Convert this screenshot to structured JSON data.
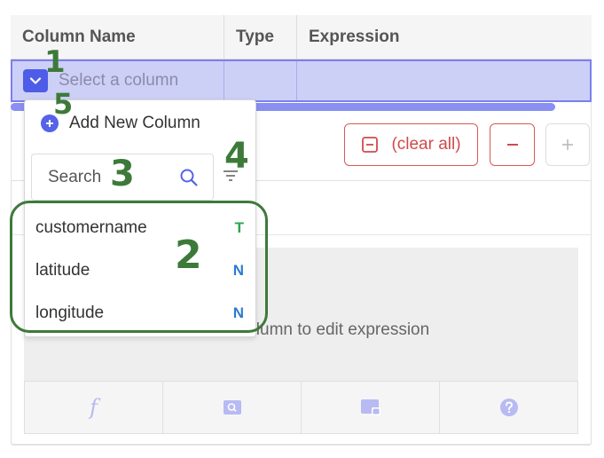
{
  "table": {
    "headers": [
      "Column Name",
      "Type",
      "Expression"
    ],
    "selected_row": {
      "placeholder": "Select a column"
    }
  },
  "actions": {
    "clear_all_label": "(clear all)",
    "minus_label": "−",
    "plus_label": "+"
  },
  "expression": {
    "hint": "Select a column to edit expression",
    "tools": [
      "function-icon",
      "search-box-icon",
      "image-card-icon",
      "help-icon"
    ],
    "function_glyph": "f"
  },
  "dropdown": {
    "add_new_label": "Add New Column",
    "search_placeholder": "Search",
    "options": [
      {
        "name": "customername",
        "type": "T",
        "type_color": "#2ea44f"
      },
      {
        "name": "latitude",
        "type": "N",
        "type_color": "#2b7bd0"
      },
      {
        "name": "longitude",
        "type": "N",
        "type_color": "#2b7bd0"
      }
    ]
  },
  "annotations": {
    "n1": "1",
    "n2": "2",
    "n3": "3",
    "n4": "4",
    "n5": "5",
    "color": "#3d7a3a"
  },
  "colors": {
    "accent": "#4d5de8",
    "row_selected": "#cdd0f6",
    "danger": "#d04a4a"
  }
}
